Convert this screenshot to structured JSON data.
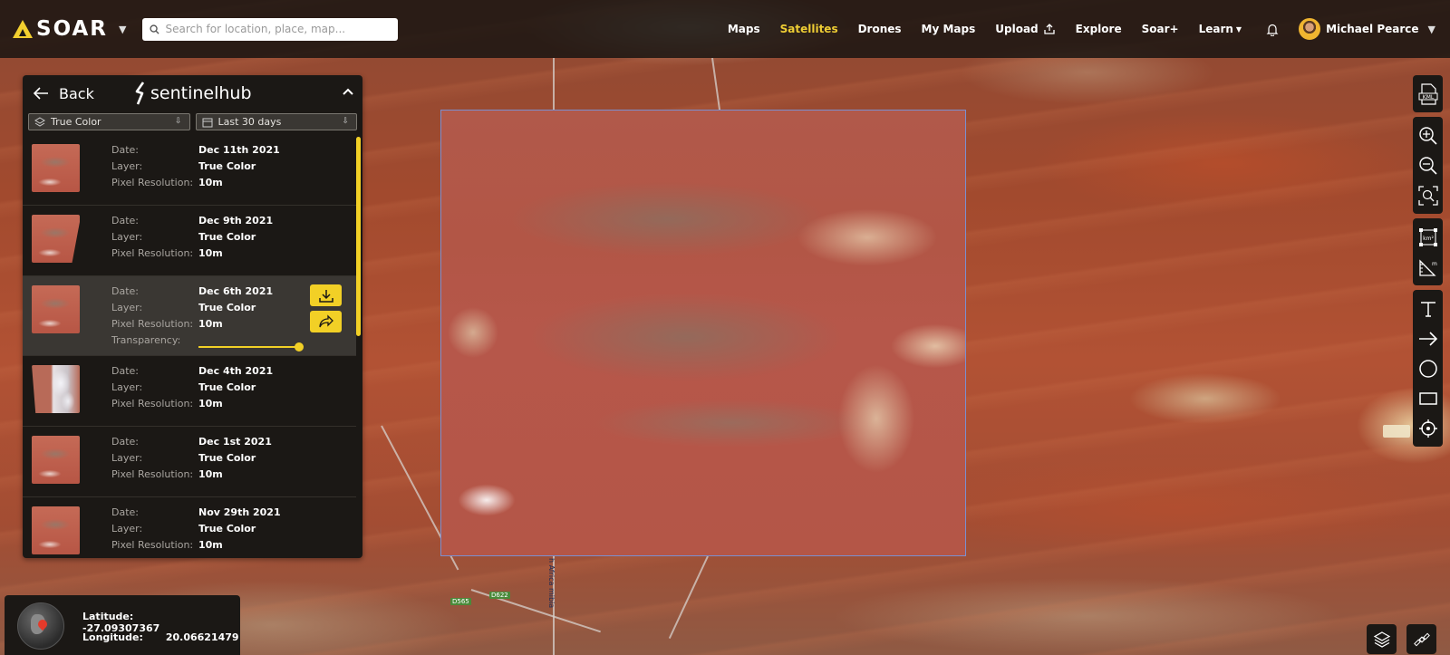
{
  "app": {
    "logo_text": "SOAR",
    "search_placeholder": "Search for location, place, map..."
  },
  "nav": {
    "maps": "Maps",
    "satellites": "Satellites",
    "drones": "Drones",
    "my_maps": "My Maps",
    "upload": "Upload",
    "explore": "Explore",
    "soar_plus": "Soar+",
    "learn": "Learn",
    "user_name": "Michael Pearce"
  },
  "panel": {
    "back_label": "Back",
    "provider": "sentinelhub",
    "layer_filter": "True Color",
    "date_filter": "Last 30 days",
    "labels": {
      "date": "Date:",
      "layer": "Layer:",
      "resolution": "Pixel Resolution:",
      "transparency": "Transparency:"
    },
    "results": [
      {
        "date": "Dec 11th 2021",
        "layer": "True Color",
        "resolution": "10m"
      },
      {
        "date": "Dec 9th 2021",
        "layer": "True Color",
        "resolution": "10m"
      },
      {
        "date": "Dec 6th 2021",
        "layer": "True Color",
        "resolution": "10m",
        "selected": true,
        "transparency": 1.0
      },
      {
        "date": "Dec 4th 2021",
        "layer": "True Color",
        "resolution": "10m"
      },
      {
        "date": "Dec 1st 2021",
        "layer": "True Color",
        "resolution": "10m"
      },
      {
        "date": "Nov 29th 2021",
        "layer": "True Color",
        "resolution": "10m"
      }
    ]
  },
  "coords": {
    "latitude_label": "Latitude:",
    "latitude_value": "-27.09307367",
    "longitude_label": "Longitude:",
    "longitude_value": "20.06621479"
  },
  "map_labels": {
    "road_1": "D565",
    "road_2": "D622",
    "place": "h Africa mibia"
  },
  "colors": {
    "accent": "#f2d026",
    "panel_bg": "#1b1815",
    "selection_box": "#7b8fd0"
  }
}
